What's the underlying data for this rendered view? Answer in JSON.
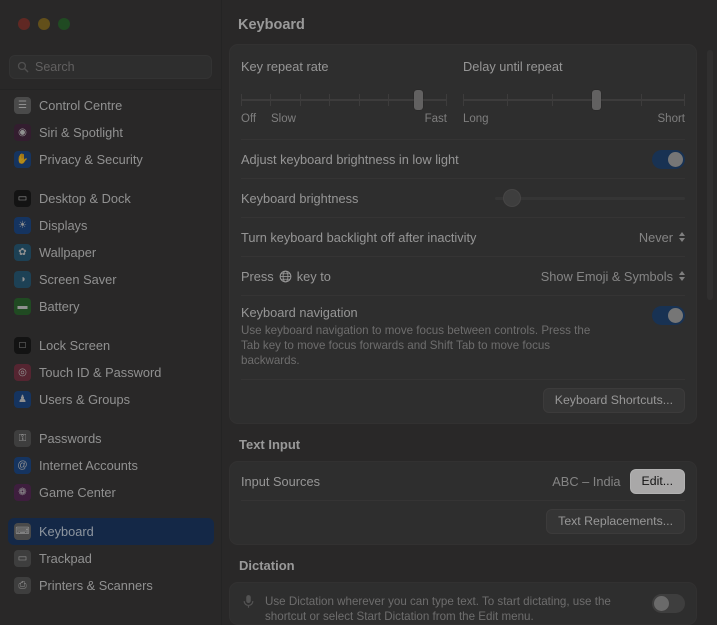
{
  "window": {
    "traffic_lights": [
      "close",
      "minimize",
      "zoom"
    ]
  },
  "search": {
    "placeholder": "Search",
    "icon": "search-icon"
  },
  "sidebar": {
    "groups": [
      {
        "items": [
          {
            "label": "Control Centre",
            "icon": "control-centre-icon",
            "color": "#6b6b6b",
            "glyph": "☰"
          },
          {
            "label": "Siri & Spotlight",
            "icon": "siri-icon",
            "color": "#4a2a44",
            "glyph": "◉"
          },
          {
            "label": "Privacy & Security",
            "icon": "privacy-icon",
            "color": "#1f4b8a",
            "glyph": "✋"
          }
        ]
      },
      {
        "items": [
          {
            "label": "Desktop & Dock",
            "icon": "desktop-dock-icon",
            "color": "#1c1c1c",
            "glyph": "▭"
          },
          {
            "label": "Displays",
            "icon": "displays-icon",
            "color": "#1f4b8a",
            "glyph": "☀"
          },
          {
            "label": "Wallpaper",
            "icon": "wallpaper-icon",
            "color": "#2a5d7a",
            "glyph": "✿"
          },
          {
            "label": "Screen Saver",
            "icon": "screen-saver-icon",
            "color": "#2a5d7a",
            "glyph": "◑"
          },
          {
            "label": "Battery",
            "icon": "battery-icon",
            "color": "#2f6b31",
            "glyph": "▬"
          }
        ]
      },
      {
        "items": [
          {
            "label": "Lock Screen",
            "icon": "lock-screen-icon",
            "color": "#1c1c1c",
            "glyph": "□"
          },
          {
            "label": "Touch ID & Password",
            "icon": "touch-id-icon",
            "color": "#7a3547",
            "glyph": "◎"
          },
          {
            "label": "Users & Groups",
            "icon": "users-groups-icon",
            "color": "#1f4b8a",
            "glyph": "♟"
          }
        ]
      },
      {
        "items": [
          {
            "label": "Passwords",
            "icon": "passwords-icon",
            "color": "#5a5959",
            "glyph": "⚿"
          },
          {
            "label": "Internet Accounts",
            "icon": "internet-accounts-icon",
            "color": "#1f4b8a",
            "glyph": "@"
          },
          {
            "label": "Game Center",
            "icon": "game-center-icon",
            "color": "#5a2b5a",
            "glyph": "❁"
          }
        ]
      },
      {
        "items": [
          {
            "label": "Keyboard",
            "icon": "keyboard-icon",
            "color": "#6b6b6b",
            "glyph": "⌨",
            "selected": true
          },
          {
            "label": "Trackpad",
            "icon": "trackpad-icon",
            "color": "#5a5959",
            "glyph": "▭"
          },
          {
            "label": "Printers & Scanners",
            "icon": "printers-scanners-icon",
            "color": "#5a5959",
            "glyph": "⎙"
          }
        ]
      }
    ]
  },
  "main": {
    "title": "Keyboard",
    "key_repeat": {
      "title": "Key repeat rate",
      "ticks": 8,
      "value_index": 6,
      "left_labels": [
        "Off",
        "Slow"
      ],
      "right_label": "Fast"
    },
    "delay_until_repeat": {
      "title": "Delay until repeat",
      "ticks": 6,
      "value_index": 3,
      "left_label": "Long",
      "right_label": "Short"
    },
    "adjust_brightness": {
      "label": "Adjust keyboard brightness in low light",
      "toggle_state": "on"
    },
    "keyboard_brightness": {
      "label": "Keyboard brightness",
      "value_percent": 4
    },
    "backlight_off": {
      "label": "Turn keyboard backlight off after inactivity",
      "value": "Never"
    },
    "press_globe_key": {
      "label_before": "Press",
      "globe_icon": "globe-icon",
      "label_after": "key to",
      "value": "Show Emoji & Symbols"
    },
    "keyboard_navigation": {
      "label": "Keyboard navigation",
      "description": "Use keyboard navigation to move focus between controls. Press the Tab key to move focus forwards and Shift Tab to move focus backwards.",
      "toggle_state": "on"
    },
    "keyboard_shortcuts_button": "Keyboard Shortcuts...",
    "text_input": {
      "heading": "Text Input",
      "input_sources_label": "Input Sources",
      "input_sources_value": "ABC – India",
      "edit_button": "Edit...",
      "text_replacements_button": "Text Replacements..."
    },
    "dictation": {
      "heading": "Dictation",
      "icon": "microphone-icon",
      "description": "Use Dictation wherever you can type text. To start dictating, use the shortcut or select Start Dictation from the Edit menu.",
      "toggle_state": "off"
    }
  },
  "colors": {
    "accent_blue": "#234877",
    "selected_sidebar": "#1d3a66",
    "card_bg": "#434242",
    "window_bg": "#3b3a3a"
  }
}
